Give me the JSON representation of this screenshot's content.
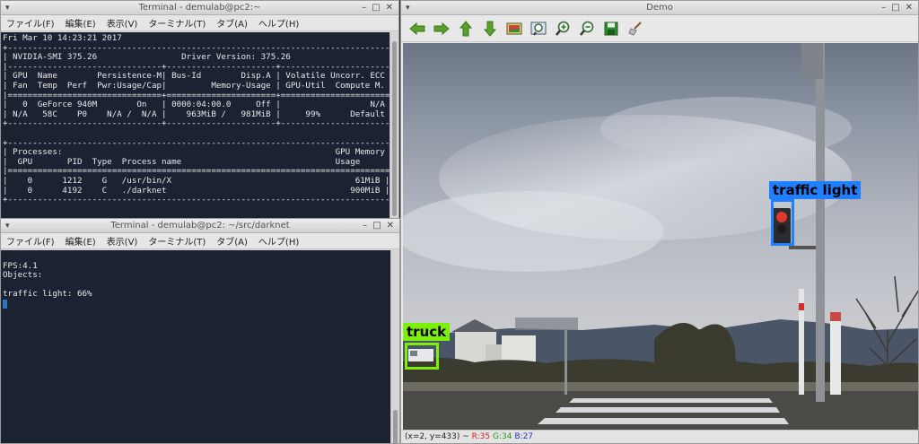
{
  "top_terminal": {
    "title": "Terminal - demulab@pc2:~",
    "menu": [
      "ファイル(F)",
      "編集(E)",
      "表示(V)",
      "ターミナル(T)",
      "タブ(A)",
      "ヘルプ(H)"
    ],
    "lines": [
      "Fri Mar 10 14:23:21 2017",
      "+-----------------------------------------------------------------------------+",
      "| NVIDIA-SMI 375.26                 Driver Version: 375.26                    |",
      "|-------------------------------+----------------------+----------------------+",
      "| GPU  Name        Persistence-M| Bus-Id        Disp.A | Volatile Uncorr. ECC |",
      "| Fan  Temp  Perf  Pwr:Usage/Cap|         Memory-Usage | GPU-Util  Compute M. |",
      "|===============================+======================+======================|",
      "|   0  GeForce 940M        On   | 0000:04:00.0     Off |                  N/A |",
      "| N/A   58C    P0    N/A /  N/A |    963MiB /   981MiB |     99%      Default |",
      "+-------------------------------+----------------------+----------------------+",
      "",
      "+-----------------------------------------------------------------------------+",
      "| Processes:                                                       GPU Memory |",
      "|  GPU       PID  Type  Process name                               Usage      |",
      "|=============================================================================|",
      "|    0      1212    G   /usr/bin/X                                     61MiB |",
      "|    0      4192    C   ./darknet                                     900MiB |",
      "+-----------------------------------------------------------------------------+"
    ]
  },
  "bottom_terminal": {
    "title": "Terminal - demulab@pc2: ~/src/darknet",
    "menu": [
      "ファイル(F)",
      "編集(E)",
      "表示(V)",
      "ターミナル(T)",
      "タブ(A)",
      "ヘルプ(H)"
    ],
    "lines": [
      "",
      "FPS:4.1",
      "Objects:",
      "",
      "traffic light: 66%"
    ]
  },
  "demo": {
    "title": "Demo",
    "toolbar": [
      "arrow-left-icon",
      "arrow-right-icon",
      "arrow-up-icon",
      "arrow-down-icon",
      "image-icon",
      "zoom-fit-icon",
      "zoom-in-icon",
      "zoom-out-icon",
      "save-icon",
      "clear-icon"
    ],
    "status_coords": "(x=2, y=433) ~",
    "status_r": "R:35",
    "status_g": "G:34",
    "status_b": "B:27",
    "colors": {
      "r": "#d62020",
      "g": "#1a9a1a",
      "b": "#2030d0"
    },
    "detections": [
      {
        "label": "traffic light",
        "color": "#1e7fff"
      },
      {
        "label": "truck",
        "color": "#7cf00a"
      }
    ]
  }
}
